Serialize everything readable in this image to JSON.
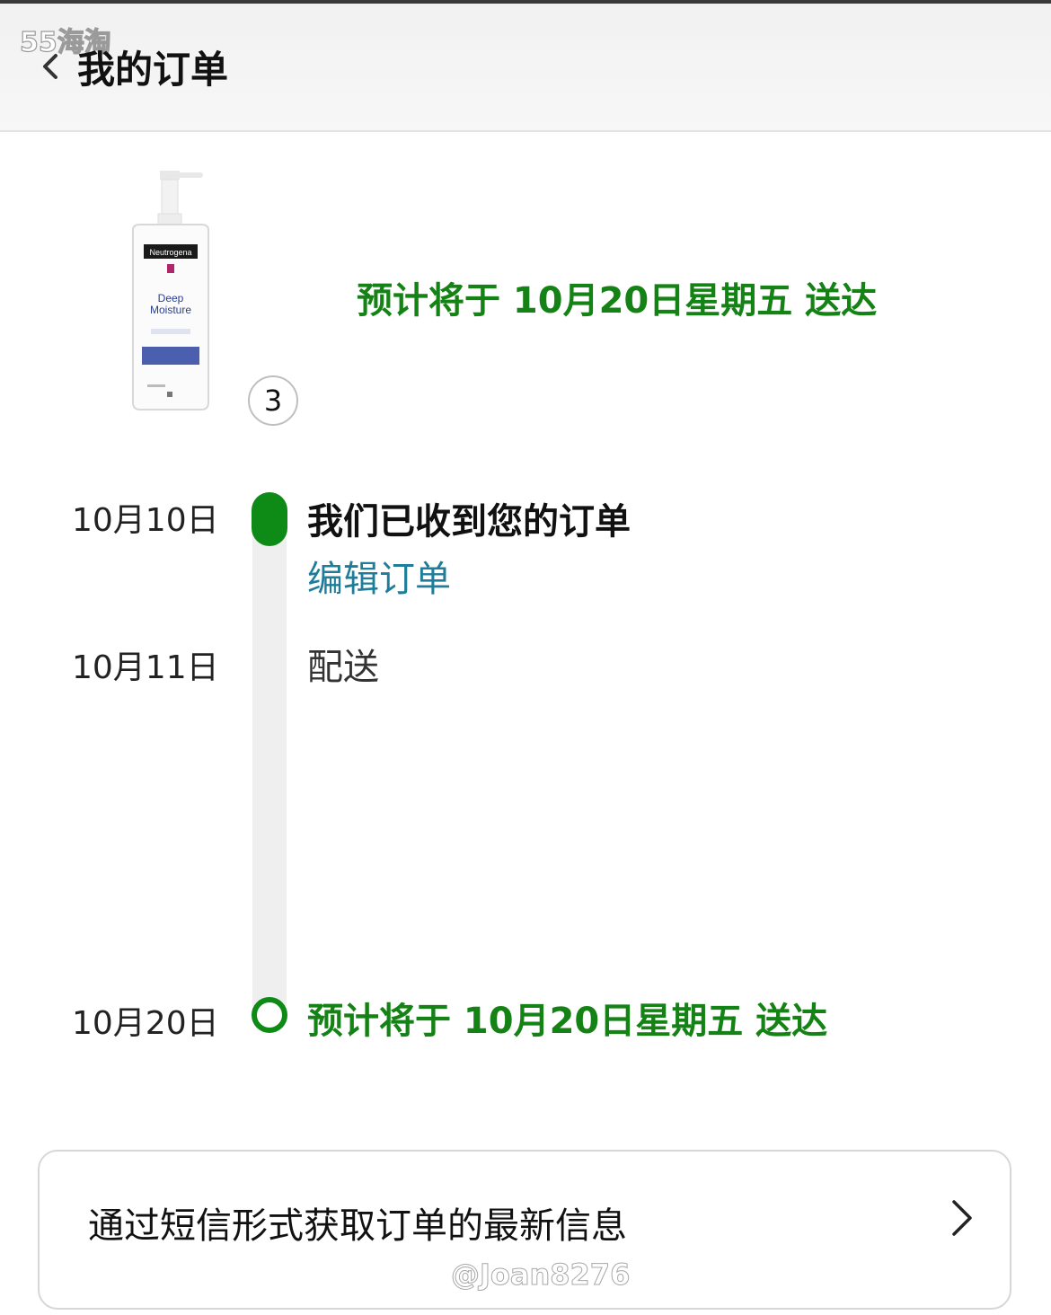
{
  "header": {
    "watermark": "55海淘",
    "back_icon": "chevron-left-icon",
    "title": "我的订单"
  },
  "product": {
    "brand": "Neutrogena",
    "name_line1": "Deep",
    "name_line2": "Moisture",
    "quantity": "3"
  },
  "eta_banner": "预计将于 10月20日星期五 送达",
  "timeline": [
    {
      "date": "10月10日",
      "title": "我们已收到您的订单",
      "link": "编辑订单",
      "status": "done"
    },
    {
      "date": "10月11日",
      "title": "配送",
      "status": "pending"
    },
    {
      "date": "10月20日",
      "title": "预计将于 10月20日星期五 送达",
      "status": "expected"
    }
  ],
  "sms": {
    "label": "通过短信形式获取订单的最新信息",
    "icon": "chevron-right-icon"
  },
  "credit": "@Joan8276",
  "colors": {
    "green": "#0e8a16",
    "link": "#1f7d99",
    "track": "#efefef"
  }
}
